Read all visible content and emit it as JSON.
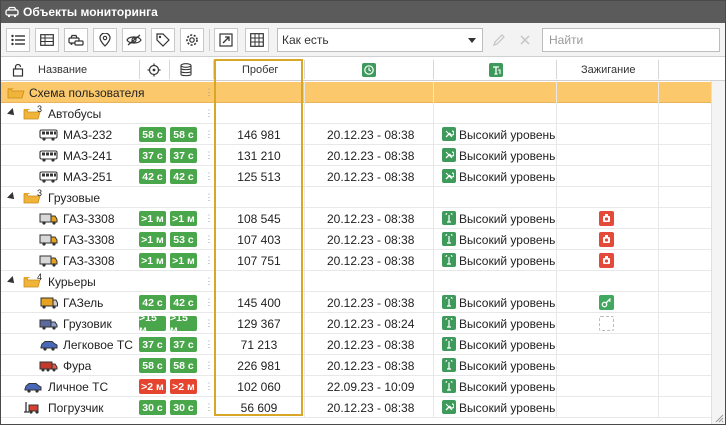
{
  "window": {
    "title": "Объекты мониторинга",
    "title_icon": "car-window-icon"
  },
  "toolbar": {
    "buttons": [
      {
        "name": "list-view-button",
        "icon": "list-icon"
      },
      {
        "name": "table-view-button",
        "icon": "table-icon"
      },
      {
        "name": "vehicles-button",
        "icon": "vehicles-icon"
      },
      {
        "name": "geozone-button",
        "icon": "map-pin-icon"
      },
      {
        "name": "hide-button",
        "icon": "eye-off-icon"
      },
      {
        "name": "tags-button",
        "icon": "tag-icon"
      },
      {
        "name": "settings-button",
        "icon": "gear-icon"
      },
      {
        "name": "export-button",
        "icon": "external-link-icon"
      },
      {
        "name": "columns-button",
        "icon": "grid-icon"
      }
    ],
    "sort_select": {
      "value": "Как есть"
    },
    "edit_icon": "pencil-icon",
    "close_icon": "close-icon",
    "search": {
      "placeholder": "Найти",
      "value": ""
    }
  },
  "columns": {
    "name_icon": "lock-icon",
    "name": "Название",
    "gps_icon": "gps-target-icon",
    "db_icon": "database-icon",
    "mileage": "Пробег",
    "last_msg_icon": "clock-icon",
    "status_icon": "status-antenna-icon",
    "ignition": "Зажигание"
  },
  "colors": {
    "accent": "#fbc96b",
    "highlight_border": "#d9a728",
    "green": "#4aa64a",
    "red": "#e5452f",
    "status_green": "#3e9a5b"
  },
  "rows": [
    {
      "type": "root",
      "label": "Схема пользователя"
    },
    {
      "type": "group",
      "label": "Автобусы",
      "count": "3"
    },
    {
      "type": "item",
      "icon": "bus-icon",
      "name": "МАЗ-232",
      "b1": "58 с",
      "b2": "58 с",
      "c1": "green",
      "c2": "green",
      "mileage": "146 981",
      "time": "20.12.23 - 08:38",
      "status_icon": "wrench-status-icon",
      "status": "Высокий уровень",
      "ignition": ""
    },
    {
      "type": "item",
      "icon": "bus-icon",
      "name": "МАЗ-241",
      "b1": "37 с",
      "b2": "37 с",
      "c1": "green",
      "c2": "green",
      "mileage": "131 210",
      "time": "20.12.23 - 08:38",
      "status_icon": "wrench-status-icon",
      "status": "Высокий уровень",
      "ignition": ""
    },
    {
      "type": "item",
      "icon": "bus-icon",
      "name": "МАЗ-251",
      "b1": "42 с",
      "b2": "42 с",
      "c1": "green",
      "c2": "green",
      "mileage": "125 513",
      "time": "20.12.23 - 08:38",
      "status_icon": "wrench-status-icon",
      "status": "Высокий уровень",
      "ignition": ""
    },
    {
      "type": "group",
      "label": "Грузовые",
      "count": "3"
    },
    {
      "type": "item",
      "icon": "van-icon",
      "name": "ГАЗ-3308",
      "b1": ">1 м",
      "b2": ">1 м",
      "c1": "green",
      "c2": "green",
      "mileage": "108 545",
      "time": "20.12.23 - 08:38",
      "status_icon": "antenna-status-icon",
      "status": "Высокий уровень",
      "ignition": "red"
    },
    {
      "type": "item",
      "icon": "van-icon",
      "name": "ГАЗ-3308",
      "b1": ">1 м",
      "b2": "53 с",
      "c1": "green",
      "c2": "green",
      "mileage": "107 403",
      "time": "20.12.23 - 08:38",
      "status_icon": "antenna-status-icon",
      "status": "Высокий уровень",
      "ignition": "red"
    },
    {
      "type": "item",
      "icon": "van-icon",
      "name": "ГАЗ-3308",
      "b1": ">1 м",
      "b2": ">1 м",
      "c1": "green",
      "c2": "green",
      "mileage": "107 751",
      "time": "20.12.23 - 08:38",
      "status_icon": "antenna-status-icon",
      "status": "Высокий уровень",
      "ignition": "red"
    },
    {
      "type": "group",
      "label": "Курьеры",
      "count": "4"
    },
    {
      "type": "item",
      "icon": "gazel-icon",
      "name": "ГАЗель",
      "b1": "42 с",
      "b2": "42 с",
      "c1": "green",
      "c2": "green",
      "mileage": "145 400",
      "time": "20.12.23 - 08:38",
      "status_icon": "antenna-status-icon",
      "status": "Высокий уровень",
      "ignition": "green"
    },
    {
      "type": "item",
      "icon": "truck-icon",
      "name": "Грузовик",
      "b1": ">15 м",
      "b2": ">15 м",
      "c1": "green",
      "c2": "green",
      "mileage": "129 367",
      "time": "20.12.23 - 08:24",
      "status_icon": "antenna-status-icon",
      "status": "Высокий уровень",
      "ignition": "empty"
    },
    {
      "type": "item",
      "icon": "car-icon",
      "name": "Легковое ТС",
      "b1": "37 с",
      "b2": "37 с",
      "c1": "green",
      "c2": "green",
      "mileage": "71 213",
      "time": "20.12.23 - 08:38",
      "status_icon": "antenna-status-icon",
      "status": "Высокий уровень",
      "ignition": ""
    },
    {
      "type": "item",
      "icon": "lorry-icon",
      "name": "Фура",
      "b1": "58 с",
      "b2": "58 с",
      "c1": "green",
      "c2": "green",
      "mileage": "226 981",
      "time": "20.12.23 - 08:38",
      "status_icon": "antenna-status-icon",
      "status": "Высокий уровень",
      "ignition": ""
    },
    {
      "type": "item-top",
      "icon": "car-icon",
      "name": "Личное ТС",
      "b1": ">2 м",
      "b2": ">2 м",
      "c1": "red",
      "c2": "red",
      "mileage": "102 060",
      "time": "22.09.23 - 10:09",
      "status_icon": "antenna-status-icon",
      "status": "Высокий уровень",
      "ignition": ""
    },
    {
      "type": "item-top",
      "icon": "loader-icon",
      "name": "Погрузчик",
      "b1": "30 с",
      "b2": "30 с",
      "c1": "green",
      "c2": "green",
      "mileage": "56 609",
      "time": "20.12.23 - 08:38",
      "status_icon": "wrench-status-icon",
      "status": "Высокий уровень",
      "ignition": ""
    }
  ]
}
